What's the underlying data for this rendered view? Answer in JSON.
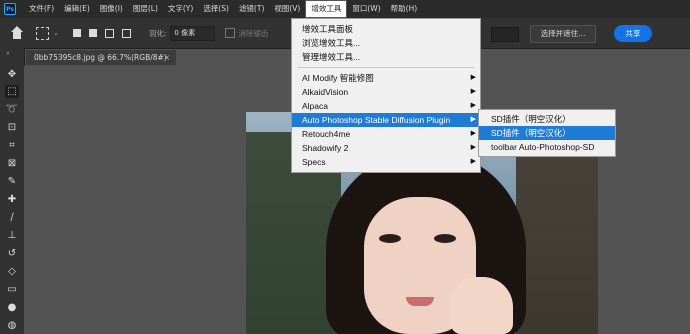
{
  "menubar": {
    "logo": "Ps",
    "items": [
      "文件(F)",
      "编辑(E)",
      "图像(I)",
      "图层(L)",
      "文字(Y)",
      "选择(S)",
      "滤镜(T)",
      "视图(V)",
      "增效工具",
      "窗口(W)",
      "帮助(H)"
    ],
    "active_index": 8
  },
  "options": {
    "feather_label": "羽化:",
    "feather_value": "0 像素",
    "antialias_label": "消除锯齿",
    "select_mask_label": "选择并遮住...",
    "share_label": "共享"
  },
  "document_tab": {
    "title": "0bb75395c8.jpg @ 66.7%(RGB/8#)",
    "close_glyph": "×"
  },
  "plugins_menu": {
    "items": [
      {
        "label": "增效工具面板",
        "has_submenu": false
      },
      {
        "label": "浏览增效工具...",
        "has_submenu": false
      },
      {
        "label": "管理增效工具...",
        "has_submenu": false
      },
      {
        "label": "AI Modify 智能修图",
        "has_submenu": true
      },
      {
        "label": "AlkaidVision",
        "has_submenu": true
      },
      {
        "label": "Alpaca",
        "has_submenu": true
      },
      {
        "label": "Auto Photoshop Stable Diffusion Plugin",
        "has_submenu": true
      },
      {
        "label": "Retouch4me",
        "has_submenu": true
      },
      {
        "label": "Shadowify 2",
        "has_submenu": true
      },
      {
        "label": "Specs",
        "has_submenu": true
      }
    ],
    "highlight_index": 6,
    "arrow_glyph": "▶"
  },
  "sd_submenu": {
    "items": [
      "SD插件（明空汉化）",
      "SD插件（明空汉化）",
      "toolbar Auto-Photoshop-SD"
    ],
    "highlight_index": 1
  },
  "colors": {
    "accent": "#1e7bd6",
    "share": "#1473e6",
    "menubar": "#2b2b2b",
    "panel": "#323232",
    "workspace": "#535353"
  }
}
